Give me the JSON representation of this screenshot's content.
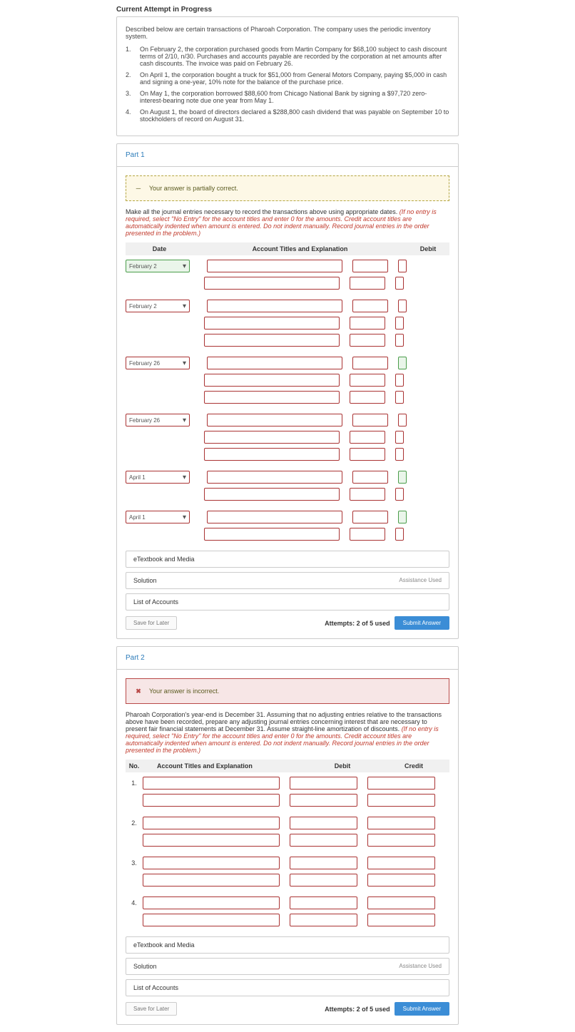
{
  "header": {
    "title": "Current Attempt in Progress"
  },
  "description": {
    "intro": "Described below are certain transactions of Pharoah Corporation. The company uses the periodic inventory system.",
    "items": [
      {
        "num": "1.",
        "text": "On February 2, the corporation purchased goods from Martin Company for $68,100 subject to cash discount terms of 2/10, n/30. Purchases and accounts payable are recorded by the corporation at net amounts after cash discounts. The invoice was paid on February 26."
      },
      {
        "num": "2.",
        "text": "On April 1, the corporation bought a truck for $51,000 from General Motors Company, paying $5,000 in cash and signing a one-year, 10% note for the balance of the purchase price."
      },
      {
        "num": "3.",
        "text": "On May 1, the corporation borrowed $88,600 from Chicago National Bank by signing a $97,720 zero-interest-bearing note due one year from May 1."
      },
      {
        "num": "4.",
        "text": "On August 1, the board of directors declared a $288,800 cash dividend that was payable on September 10 to stockholders of record on August 31."
      }
    ]
  },
  "part1": {
    "title": "Part 1",
    "alert": "Your answer is partially correct.",
    "instruct_plain": "Make all the journal entries necessary to record the transactions above using appropriate dates. ",
    "instruct_red": "(If no entry is required, select \"No Entry\" for the account titles and enter 0 for the amounts. Credit account titles are automatically indented when amount is entered. Do not indent manually. Record journal entries in the order presented in the problem.)",
    "columns": {
      "date": "Date",
      "account": "Account Titles and Explanation",
      "debit": "Debit"
    },
    "rows": [
      {
        "date": "February 2"
      },
      {
        "date": "February 2"
      },
      {
        "date": "February 26"
      },
      {
        "date": "February 26"
      },
      {
        "date": "April 1"
      },
      {
        "date": "April 1"
      }
    ],
    "attempts": "Attempts: 2 of 5 used"
  },
  "part2": {
    "title": "Part 2",
    "alert": "Your answer is incorrect.",
    "instruct_plain": "Pharoah Corporation's year-end is December 31. Assuming that no adjusting entries relative to the transactions above have been recorded, prepare any adjusting journal entries concerning interest that are necessary to present fair financial statements at December 31. Assume straight-line amortization of discounts. ",
    "instruct_red": "(If no entry is required, select \"No Entry\" for the account titles and enter 0 for the amounts. Credit account titles are automatically indented when amount is entered. Do not indent manually. Record journal entries in the order presented in the problem.)",
    "columns": {
      "no": "No.",
      "account": "Account Titles and Explanation",
      "debit": "Debit",
      "credit": "Credit"
    },
    "rows": [
      "1.",
      "2.",
      "3.",
      "4."
    ],
    "attempts": "Attempts: 2 of 5 used"
  },
  "links": {
    "etextbook": "eTextbook and Media",
    "solution": "Solution",
    "assistance": "Assistance Used",
    "list_accounts": "List of Accounts"
  },
  "buttons": {
    "save": "Save for Later",
    "submit": "Submit Answer"
  }
}
